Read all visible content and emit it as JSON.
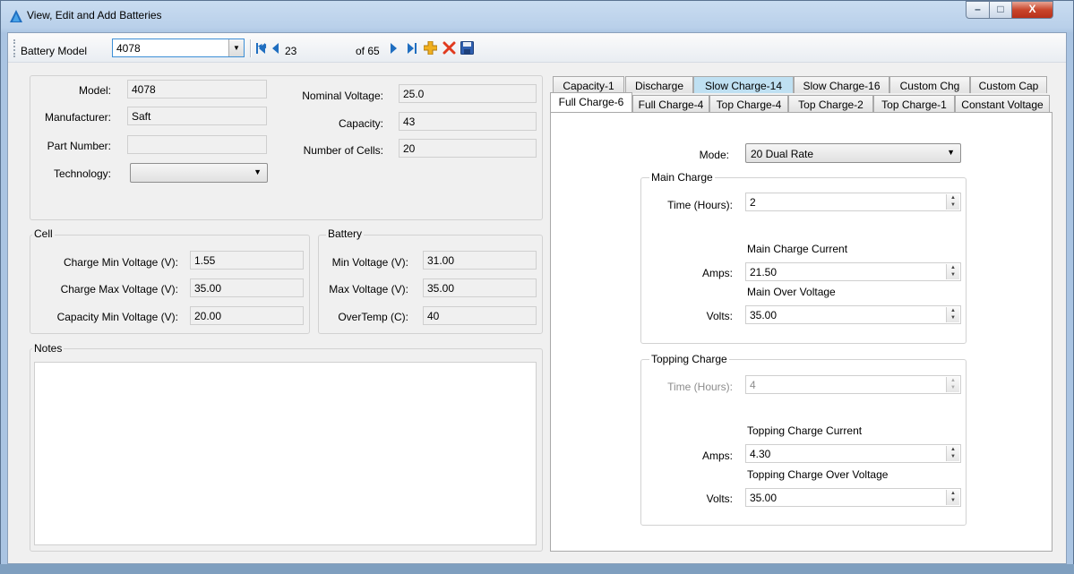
{
  "window": {
    "title": "View, Edit and Add Batteries",
    "minimize": "–",
    "maximize": "□",
    "close": "X"
  },
  "toolbar": {
    "battery_model_label": "Battery Model",
    "battery_model_value": "4078",
    "record_position": "23",
    "record_total": "of 65",
    "icons": [
      "move-first-icon",
      "move-previous-icon",
      "move-next-icon",
      "move-last-icon",
      "add-new-icon",
      "delete-icon",
      "save-icon"
    ]
  },
  "info": {
    "model_label": "Model:",
    "model_value": "4078",
    "manufacturer_label": "Manufacturer:",
    "manufacturer_value": "Saft",
    "part_number_label": "Part Number:",
    "part_number_value": "",
    "technology_label": "Technology:",
    "technology_value": "",
    "nominal_voltage_label": "Nominal Voltage:",
    "nominal_voltage_value": "25.0",
    "capacity_label": "Capacity:",
    "capacity_value": "43",
    "cells_label": "Number of Cells:",
    "cells_value": "20"
  },
  "cell": {
    "title": "Cell",
    "charge_min_label": "Charge Min Voltage (V):",
    "charge_min_value": "1.55",
    "charge_max_label": "Charge Max Voltage (V):",
    "charge_max_value": "35.00",
    "capacity_min_label": "Capacity Min Voltage (V):",
    "capacity_min_value": "20.00"
  },
  "battery": {
    "title": "Battery",
    "min_label": "Min Voltage (V):",
    "min_value": "31.00",
    "max_label": "Max Voltage (V):",
    "max_value": "35.00",
    "overtemp_label": "OverTemp (C):",
    "overtemp_value": "40"
  },
  "notes": {
    "title": "Notes",
    "value": ""
  },
  "tabs": {
    "row1": [
      "Capacity-1",
      "Discharge",
      "Slow Charge-14",
      "Slow Charge-16",
      "Custom Chg",
      "Custom Cap"
    ],
    "row2": [
      "Full Charge-6",
      "Full Charge-4",
      "Top Charge-4",
      "Top Charge-2",
      "Top Charge-1",
      "Constant Voltage"
    ],
    "selected": "Full Charge-6"
  },
  "charge": {
    "mode_label": "Mode:",
    "mode_value": "20 Dual Rate",
    "main": {
      "title": "Main Charge",
      "time_label": "Time (Hours):",
      "time_value": "2",
      "current_caption": "Main Charge Current",
      "amps_label": "Amps:",
      "amps_value": "21.50",
      "voltage_caption": "Main Over Voltage",
      "volts_label": "Volts:",
      "volts_value": "35.00"
    },
    "topping": {
      "title": "Topping Charge",
      "time_label": "Time (Hours):",
      "time_value": "4",
      "current_caption": "Topping Charge Current",
      "amps_label": "Amps:",
      "amps_value": "4.30",
      "voltage_caption": "Topping Charge Over Voltage",
      "volts_label": "Volts:",
      "volts_value": "35.00"
    }
  },
  "colors": {
    "accent": "#1f6ec0",
    "tab_highlight": "#bfe0f2",
    "delete": "#e03a1e",
    "add": "#f0b020"
  }
}
